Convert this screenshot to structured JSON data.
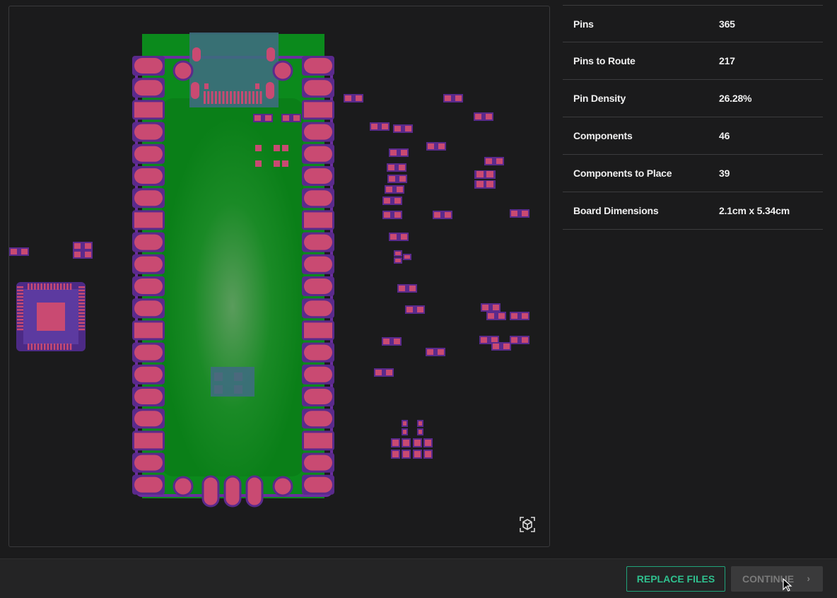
{
  "stats": {
    "rows": [
      {
        "label": "Pins",
        "value": "365"
      },
      {
        "label": "Pins to Route",
        "value": "217"
      },
      {
        "label": "Pin Density",
        "value": "26.28%"
      },
      {
        "label": "Components",
        "value": "46"
      },
      {
        "label": "Components to Place",
        "value": "39"
      },
      {
        "label": "Board Dimensions",
        "value": "2.1cm x 5.34cm"
      }
    ]
  },
  "footer": {
    "replace_label": "REPLACE FILES",
    "continue_label": "CONTINUE",
    "continue_icon": "chevron-right-icon"
  },
  "viewer": {
    "view3d_icon": "cube-3d-icon",
    "colors": {
      "board": "#0b8a1c",
      "pad": "#c94a72",
      "outline": "#5a2a8c",
      "usb": "#3f6a7a"
    }
  }
}
